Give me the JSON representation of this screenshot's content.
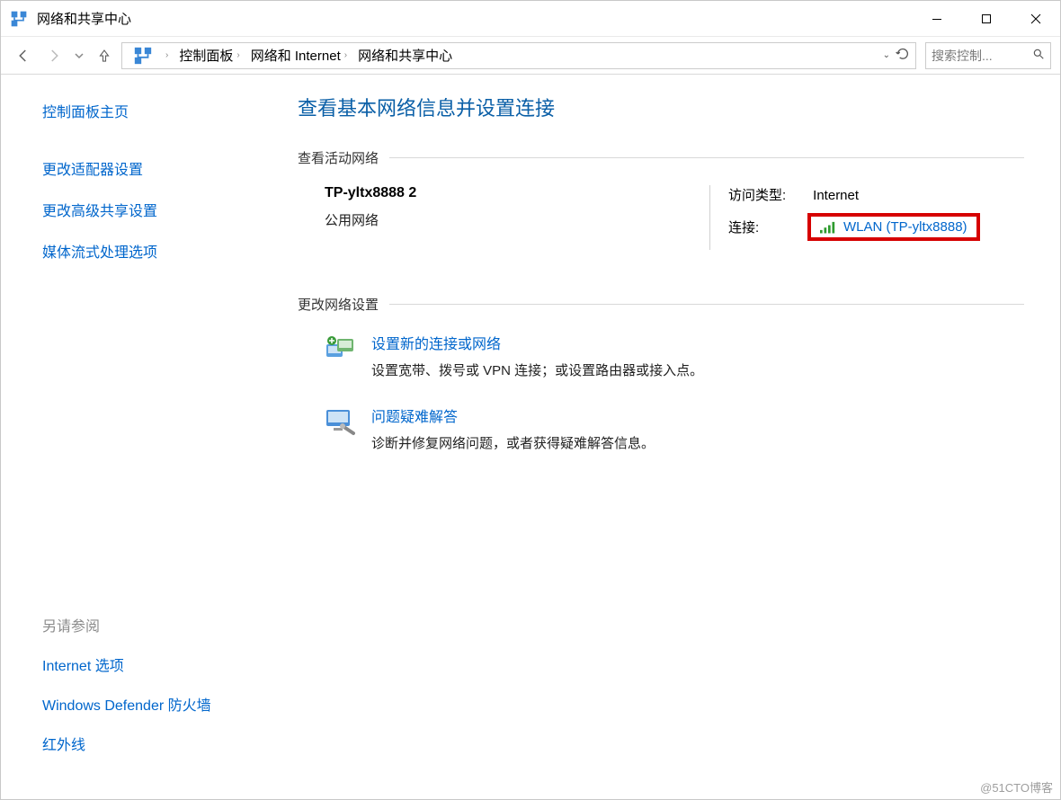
{
  "window": {
    "title": "网络和共享中心"
  },
  "breadcrumb": {
    "items": [
      "控制面板",
      "网络和 Internet",
      "网络和共享中心"
    ]
  },
  "search": {
    "placeholder": "搜索控制..."
  },
  "sidebar": {
    "home": "控制面板主页",
    "links": [
      "更改适配器设置",
      "更改高级共享设置",
      "媒体流式处理选项"
    ],
    "seeAlsoHeading": "另请参阅",
    "seeAlso": [
      "Internet 选项",
      "Windows Defender 防火墙",
      "红外线"
    ]
  },
  "content": {
    "heading": "查看基本网络信息并设置连接",
    "activeSection": "查看活动网络",
    "network": {
      "name": "TP-yltx8888 2",
      "type": "公用网络",
      "accessLabel": "访问类型:",
      "accessValue": "Internet",
      "connLabel": "连接:",
      "connValue": "WLAN (TP-yltx8888)"
    },
    "changeSection": "更改网络设置",
    "options": [
      {
        "title": "设置新的连接或网络",
        "desc": "设置宽带、拨号或 VPN 连接；或设置路由器或接入点。"
      },
      {
        "title": "问题疑难解答",
        "desc": "诊断并修复网络问题，或者获得疑难解答信息。"
      }
    ]
  },
  "watermark": "@51CTO博客"
}
